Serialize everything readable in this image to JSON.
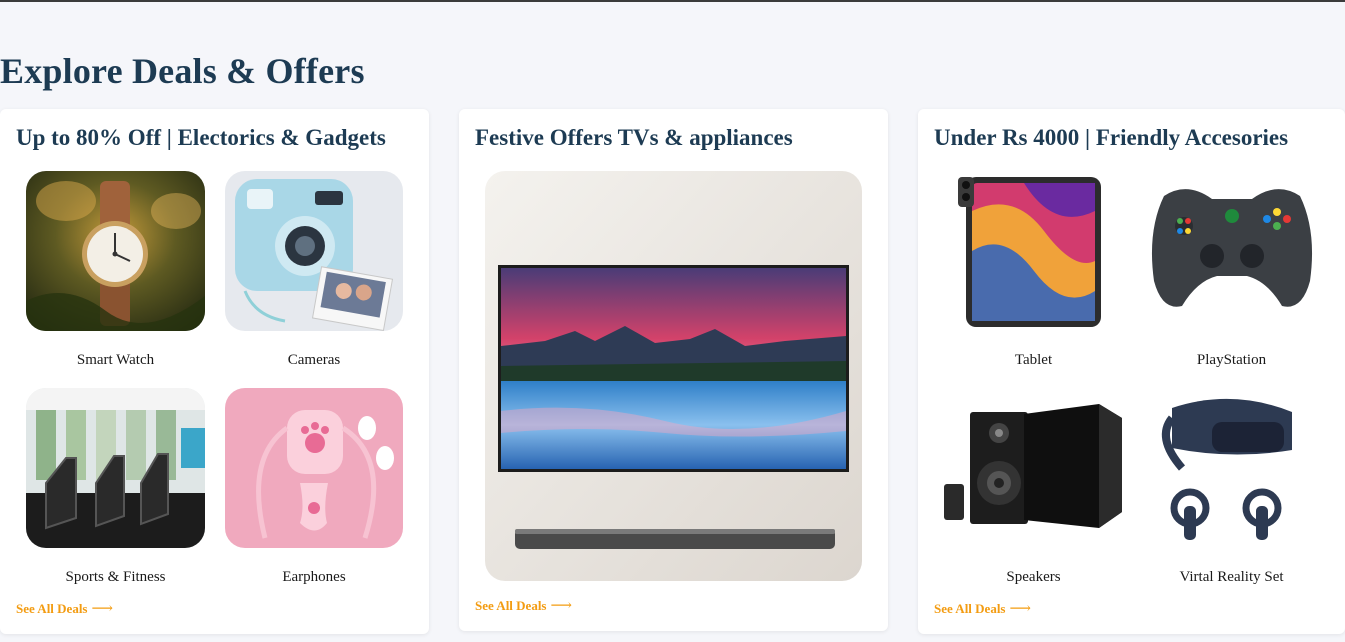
{
  "page": {
    "title": "Explore Deals & Offers"
  },
  "cards": [
    {
      "title": "Up to 80% Off | Electorics & Gadgets",
      "items": [
        {
          "label": "Smart Watch",
          "icon": "watch-image"
        },
        {
          "label": "Cameras",
          "icon": "camera-image"
        },
        {
          "label": "Sports & Fitness",
          "icon": "treadmill-image"
        },
        {
          "label": "Earphones",
          "icon": "earphones-image"
        }
      ],
      "link": "See All Deals"
    },
    {
      "title": "Festive Offers TVs & appliances",
      "items": [],
      "link": "See All Deals"
    },
    {
      "title": "Under Rs 4000 | Friendly Accesories",
      "items": [
        {
          "label": "Tablet",
          "icon": "tablet-image"
        },
        {
          "label": "PlayStation",
          "icon": "gamepad-image"
        },
        {
          "label": "Speakers",
          "icon": "speakers-image"
        },
        {
          "label": "Virtal Reality Set",
          "icon": "vr-headset-image"
        }
      ],
      "link": "See All Deals"
    }
  ],
  "colors": {
    "title": "#1d3b53",
    "link": "#f39c12",
    "background": "#f5f6fa"
  }
}
